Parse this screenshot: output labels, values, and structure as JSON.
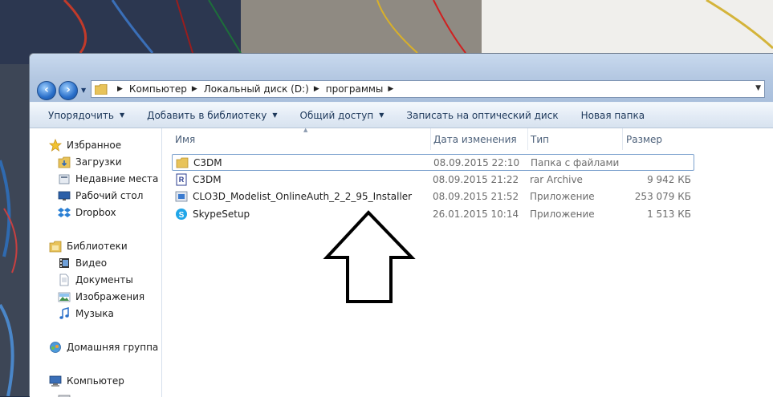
{
  "address": {
    "crumbs": [
      "Компьютер",
      "Локальный диск (D:)",
      "программы"
    ]
  },
  "toolbar": {
    "organize": "Упорядочить",
    "add_library": "Добавить в библиотеку",
    "share": "Общий доступ",
    "burn": "Записать на оптический диск",
    "new_folder": "Новая папка"
  },
  "navpane": {
    "favorites": "Избранное",
    "downloads": "Загрузки",
    "recent": "Недавние места",
    "desktop": "Рабочий стол",
    "dropbox": "Dropbox",
    "libraries": "Библиотеки",
    "video": "Видео",
    "documents": "Документы",
    "images": "Изображения",
    "music": "Музыка",
    "homegroup": "Домашняя группа",
    "computer": "Компьютер"
  },
  "columns": {
    "name": "Имя",
    "date": "Дата изменения",
    "type": "Тип",
    "size": "Размер"
  },
  "files": [
    {
      "name": "C3DM",
      "date": "08.09.2015 22:10",
      "type": "Папка с файлами",
      "size": "",
      "icon": "folder-icon"
    },
    {
      "name": "C3DM",
      "date": "08.09.2015 21:22",
      "type": "rar Archive",
      "size": "9 942 КБ",
      "icon": "rar-archive-icon"
    },
    {
      "name": "CLO3D_Modelist_OnlineAuth_2_2_95_Installer",
      "date": "08.09.2015 21:52",
      "type": "Приложение",
      "size": "253 079 КБ",
      "icon": "installer-icon"
    },
    {
      "name": "SkypeSetup",
      "date": "26.01.2015 10:14",
      "type": "Приложение",
      "size": "1 513 КБ",
      "icon": "skype-icon"
    }
  ],
  "colors": {
    "accent": "#1e395b",
    "selection_border": "#7da2ce"
  }
}
